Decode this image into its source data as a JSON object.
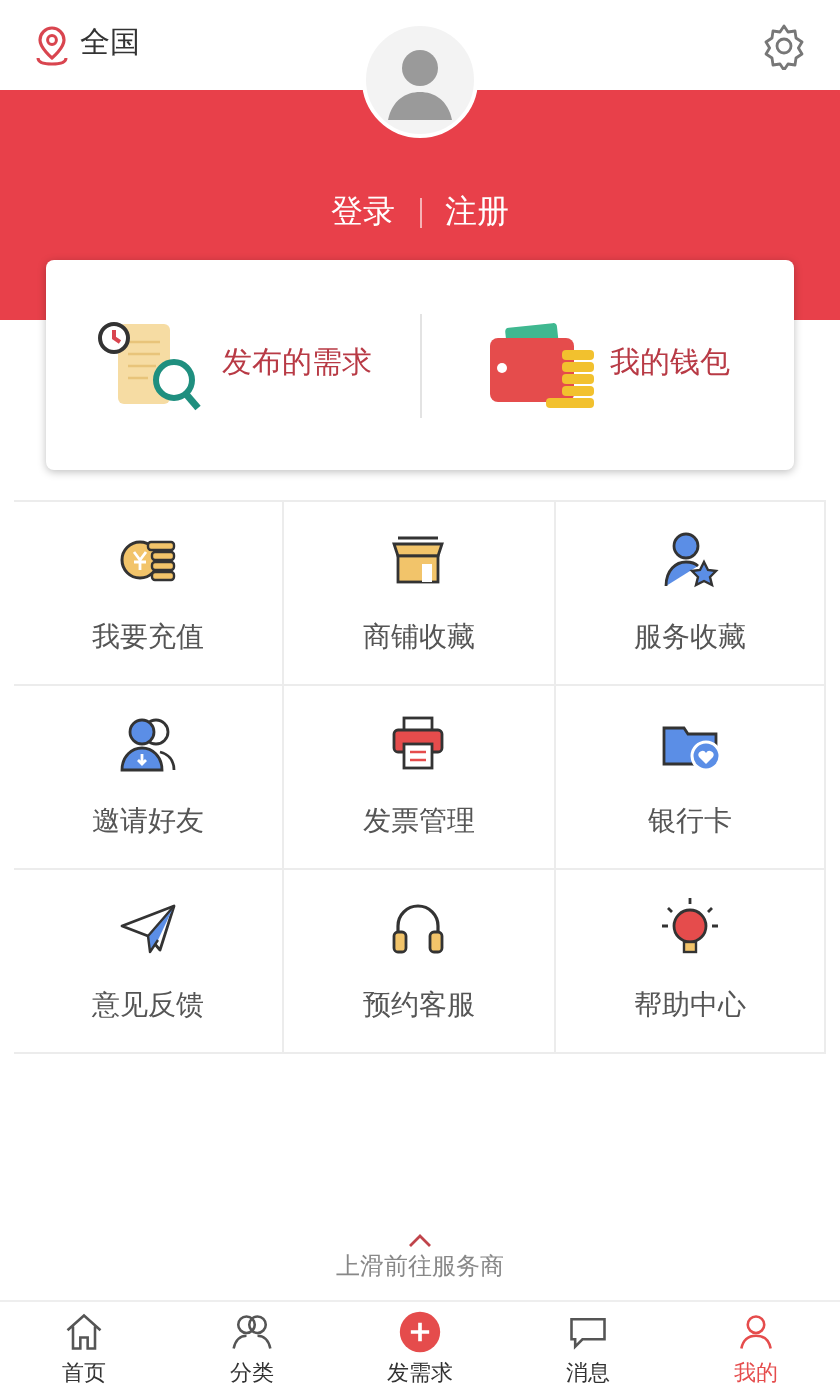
{
  "location": "全国",
  "auth": {
    "login": "登录",
    "register": "注册"
  },
  "shortcuts": [
    {
      "label": "发布的需求"
    },
    {
      "label": "我的钱包"
    }
  ],
  "grid": [
    {
      "label": "我要充值"
    },
    {
      "label": "商铺收藏"
    },
    {
      "label": "服务收藏"
    },
    {
      "label": "邀请好友"
    },
    {
      "label": "发票管理"
    },
    {
      "label": "银行卡"
    },
    {
      "label": "意见反馈"
    },
    {
      "label": "预约客服"
    },
    {
      "label": "帮助中心"
    }
  ],
  "swipe_hint": "上滑前往服务商",
  "tab_bar": [
    {
      "label": "首页",
      "selected": false
    },
    {
      "label": "分类",
      "selected": false
    },
    {
      "label": "发需求",
      "selected": false
    },
    {
      "label": "消息",
      "selected": false
    },
    {
      "label": "我的",
      "selected": true
    }
  ]
}
